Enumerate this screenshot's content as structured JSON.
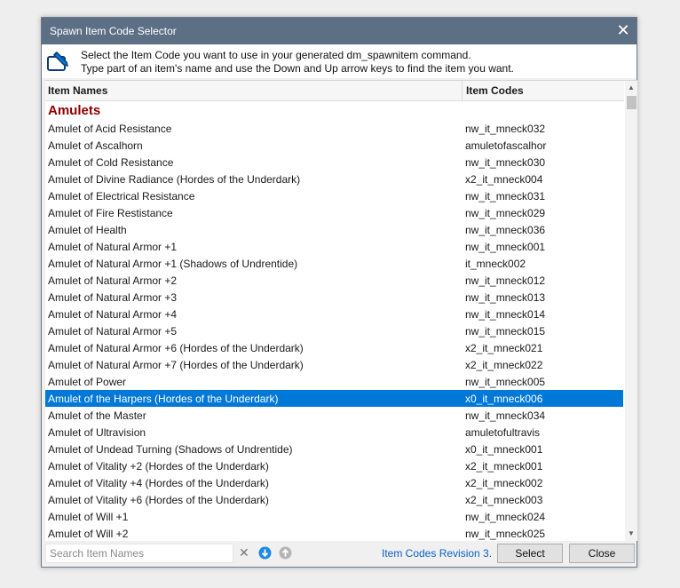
{
  "window": {
    "title": "Spawn Item Code Selector",
    "close_glyph": "✕"
  },
  "intro": {
    "line1": "Select the Item Code you want to use in your generated dm_spawnitem command.",
    "line2": "Type part of an item's name and use the Down and Up arrow keys to find the item you want.",
    "icon": "edit-pencil-icon"
  },
  "table": {
    "columns": [
      "Item Names",
      "Item Codes"
    ],
    "group_label": "Amulets",
    "selected_index": 16,
    "rows": [
      {
        "name": "Amulet of Acid Resistance",
        "code": "nw_it_mneck032"
      },
      {
        "name": "Amulet of Ascalhorn",
        "code": "amuletofascalhor"
      },
      {
        "name": "Amulet of Cold Resistance",
        "code": "nw_it_mneck030"
      },
      {
        "name": "Amulet of Divine Radiance (Hordes of the Underdark)",
        "code": "x2_it_mneck004"
      },
      {
        "name": "Amulet of Electrical Resistance",
        "code": "nw_it_mneck031"
      },
      {
        "name": "Amulet of Fire Restistance",
        "code": "nw_it_mneck029"
      },
      {
        "name": "Amulet of Health",
        "code": "nw_it_mneck036"
      },
      {
        "name": "Amulet of Natural Armor +1",
        "code": "nw_it_mneck001"
      },
      {
        "name": "Amulet of Natural Armor +1 (Shadows of Undrentide)",
        "code": "it_mneck002"
      },
      {
        "name": "Amulet of Natural Armor +2",
        "code": "nw_it_mneck012"
      },
      {
        "name": "Amulet of Natural Armor +3",
        "code": "nw_it_mneck013"
      },
      {
        "name": "Amulet of Natural Armor +4",
        "code": "nw_it_mneck014"
      },
      {
        "name": "Amulet of Natural Armor +5",
        "code": "nw_it_mneck015"
      },
      {
        "name": "Amulet of Natural Armor +6 (Hordes of the Underdark)",
        "code": "x2_it_mneck021"
      },
      {
        "name": "Amulet of Natural Armor +7 (Hordes of the Underdark)",
        "code": "x2_it_mneck022"
      },
      {
        "name": "Amulet of Power",
        "code": "nw_it_mneck005"
      },
      {
        "name": "Amulet of the Harpers (Hordes of the Underdark)",
        "code": "x0_it_mneck006"
      },
      {
        "name": "Amulet of the Master",
        "code": "nw_it_mneck034"
      },
      {
        "name": "Amulet of Ultravision",
        "code": "amuletofultravis"
      },
      {
        "name": "Amulet of Undead Turning (Shadows of Undrentide)",
        "code": "x0_it_mneck001"
      },
      {
        "name": "Amulet of Vitality +2 (Hordes of the Underdark)",
        "code": "x2_it_mneck001"
      },
      {
        "name": "Amulet of Vitality +4 (Hordes of the Underdark)",
        "code": "x2_it_mneck002"
      },
      {
        "name": "Amulet of Vitality +6 (Hordes of the Underdark)",
        "code": "x2_it_mneck003"
      },
      {
        "name": "Amulet of Will +1",
        "code": "nw_it_mneck024"
      },
      {
        "name": "Amulet of Will +2",
        "code": "nw_it_mneck025"
      }
    ]
  },
  "footer": {
    "search_placeholder": "Search Item Names",
    "search_value": "",
    "clear_glyph": "✕",
    "revision_link": "Item Codes Revision 3.",
    "select_button": "Select",
    "close_button": "Close"
  },
  "colors": {
    "titlebar": "#5d6f84",
    "selection": "#0078d7",
    "group_label": "#8b0000",
    "link": "#0a62c2"
  }
}
